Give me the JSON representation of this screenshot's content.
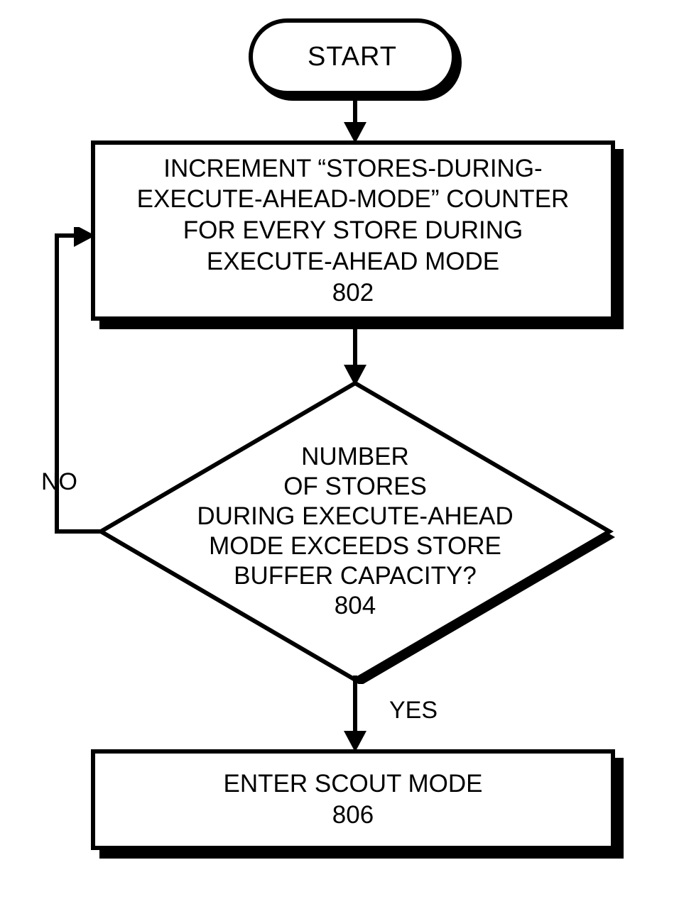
{
  "start": {
    "label": "START"
  },
  "step802": {
    "text": "INCREMENT “STORES-DURING-\nEXECUTE-AHEAD-MODE” COUNTER\nFOR EVERY STORE DURING\nEXECUTE-AHEAD MODE\n802"
  },
  "decision804": {
    "text": "NUMBER\nOF STORES\nDURING EXECUTE-AHEAD\nMODE EXCEEDS STORE\nBUFFER CAPACITY?\n804"
  },
  "labels": {
    "no": "NO",
    "yes": "YES"
  },
  "step806": {
    "text": "ENTER SCOUT MODE\n806"
  }
}
